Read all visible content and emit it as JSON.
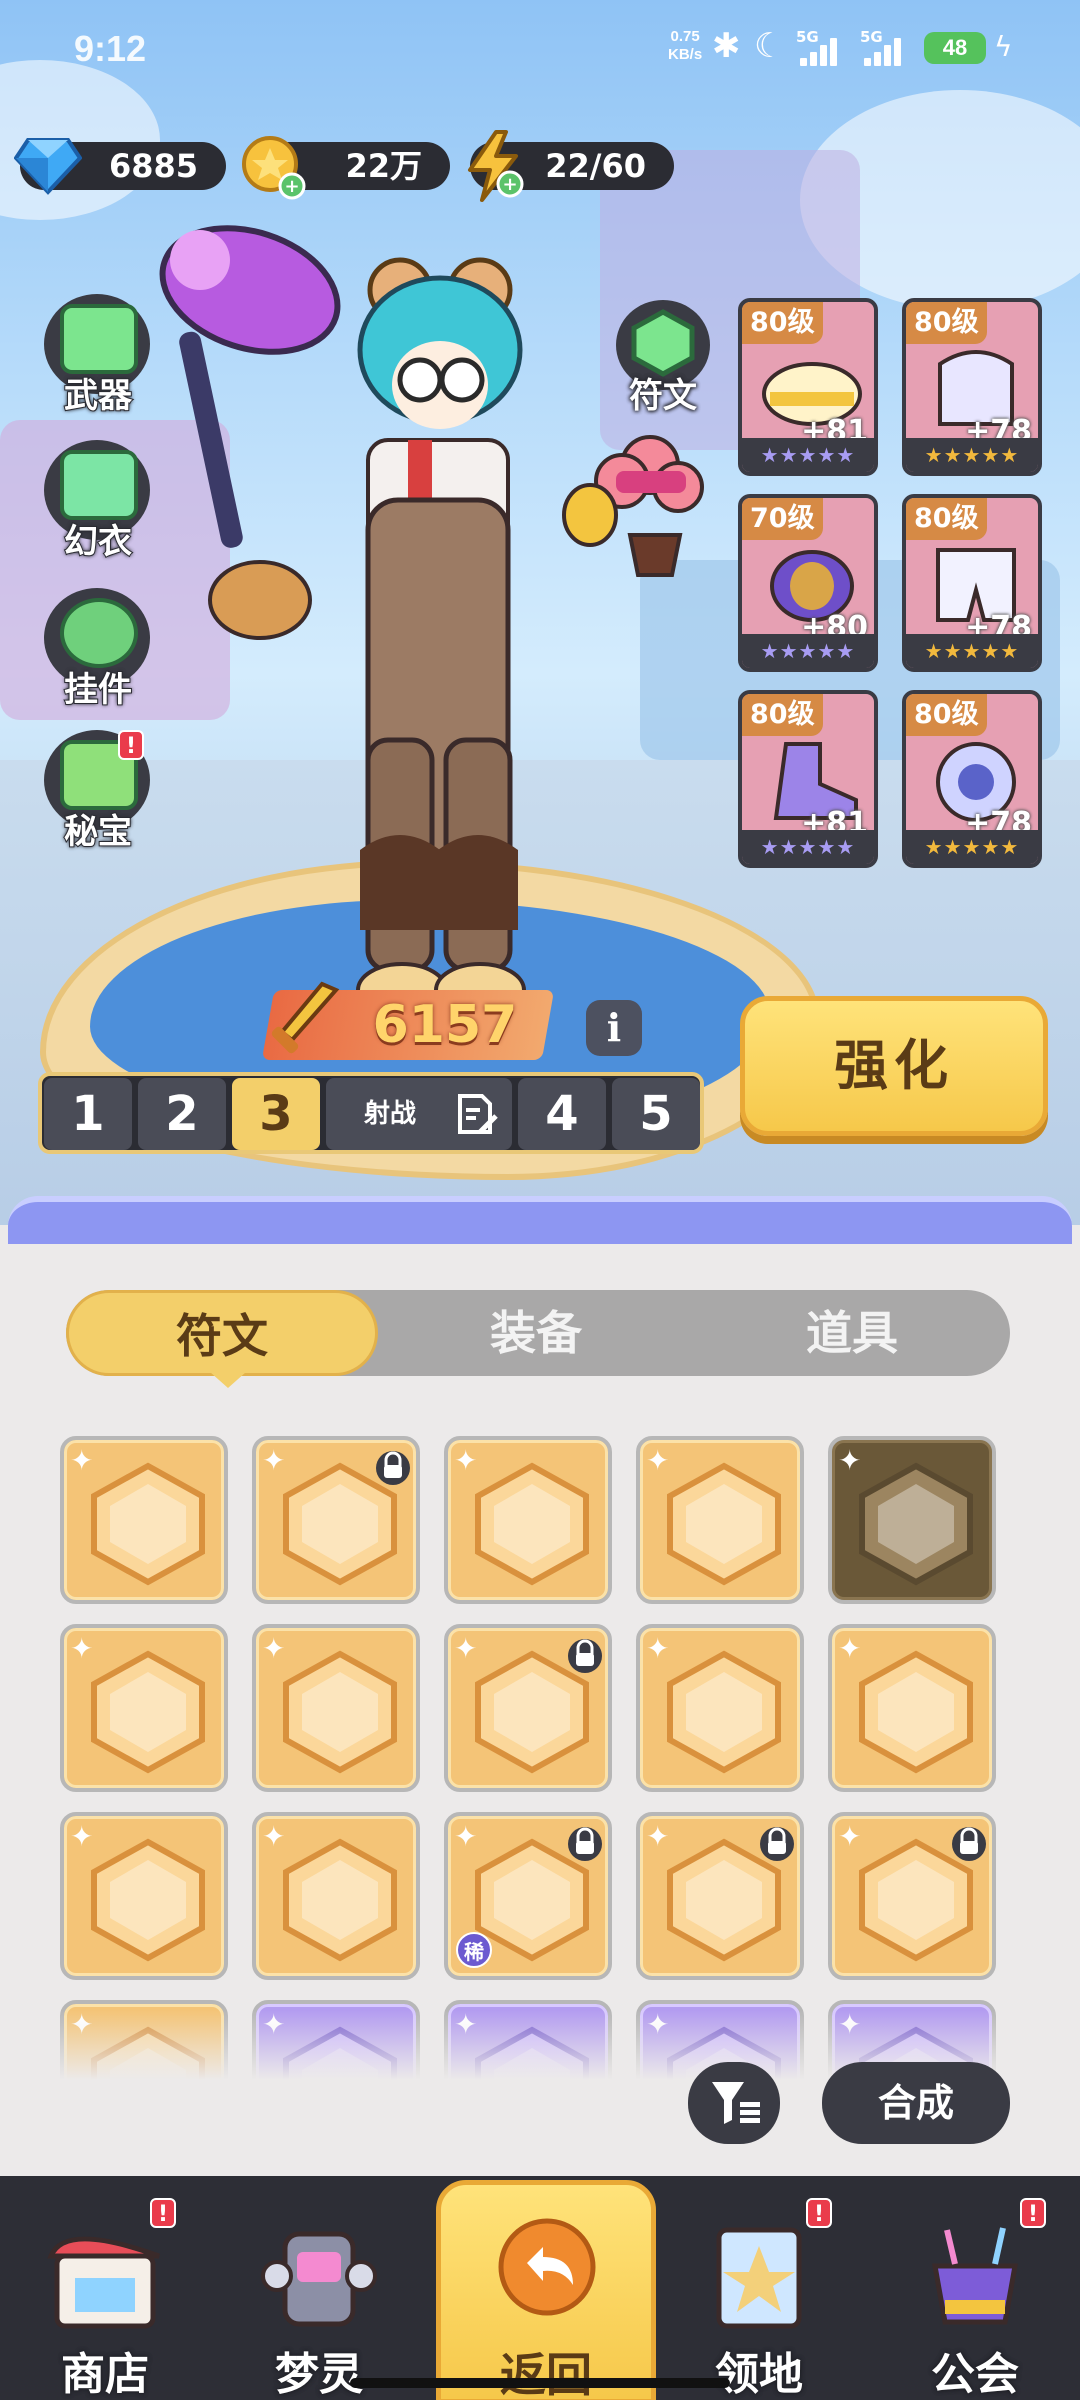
{
  "status_bar": {
    "time": "9:12",
    "net_speed_value": "0.75",
    "net_speed_unit": "KB/s",
    "network_a": "5G",
    "network_b": "5G",
    "battery": "48"
  },
  "resources": [
    {
      "name": "gem",
      "value": "6885"
    },
    {
      "name": "coin",
      "value": "22万"
    },
    {
      "name": "energy",
      "value": "22/60"
    }
  ],
  "side_menu": [
    {
      "label": "武器",
      "icon": "weapon-icon"
    },
    {
      "label": "幻衣",
      "icon": "outfit-icon"
    },
    {
      "label": "挂件",
      "icon": "pendant-icon"
    },
    {
      "label": "秘宝",
      "icon": "treasure-icon",
      "badge": "!"
    }
  ],
  "rune_button": {
    "label": "符文"
  },
  "equipment": [
    {
      "level": "80级",
      "plus": "+81",
      "stars": "★★★★★",
      "icon": "helmet-icon"
    },
    {
      "level": "80级",
      "plus": "+78",
      "stars": "★★★★★",
      "icon": "armor-icon"
    },
    {
      "level": "70级",
      "plus": "+80",
      "stars": "★★★★★",
      "icon": "bracer-icon"
    },
    {
      "level": "80级",
      "plus": "+78",
      "stars": "★★★★★",
      "icon": "pants-icon"
    },
    {
      "level": "80级",
      "plus": "+81",
      "stars": "★★★★★",
      "icon": "boots-icon"
    },
    {
      "level": "80级",
      "plus": "+78",
      "stars": "★★★★★",
      "icon": "orb-icon"
    }
  ],
  "power": "6157",
  "info_label": "i",
  "loadouts": {
    "slot1": "1",
    "slot2": "2",
    "slot3": "3",
    "name": "射战",
    "slot4": "4",
    "slot5": "5"
  },
  "upgrade_label": "强化",
  "tabs": [
    "符文",
    "装备",
    "道具"
  ],
  "rare_label": "稀",
  "combine_label": "合成",
  "bottom_nav": [
    {
      "label": "商店",
      "badge": "!"
    },
    {
      "label": "梦灵"
    },
    {
      "label": "返回"
    },
    {
      "label": "领地",
      "badge": "!"
    },
    {
      "label": "公会",
      "badge": "!"
    }
  ],
  "colors": {
    "accent_gold": "#f3cf6a",
    "panel_purple": "#8d96f2",
    "dark": "#2b2c33",
    "rune_orange": "#f4c477",
    "rune_purple": "#b39cf0"
  }
}
